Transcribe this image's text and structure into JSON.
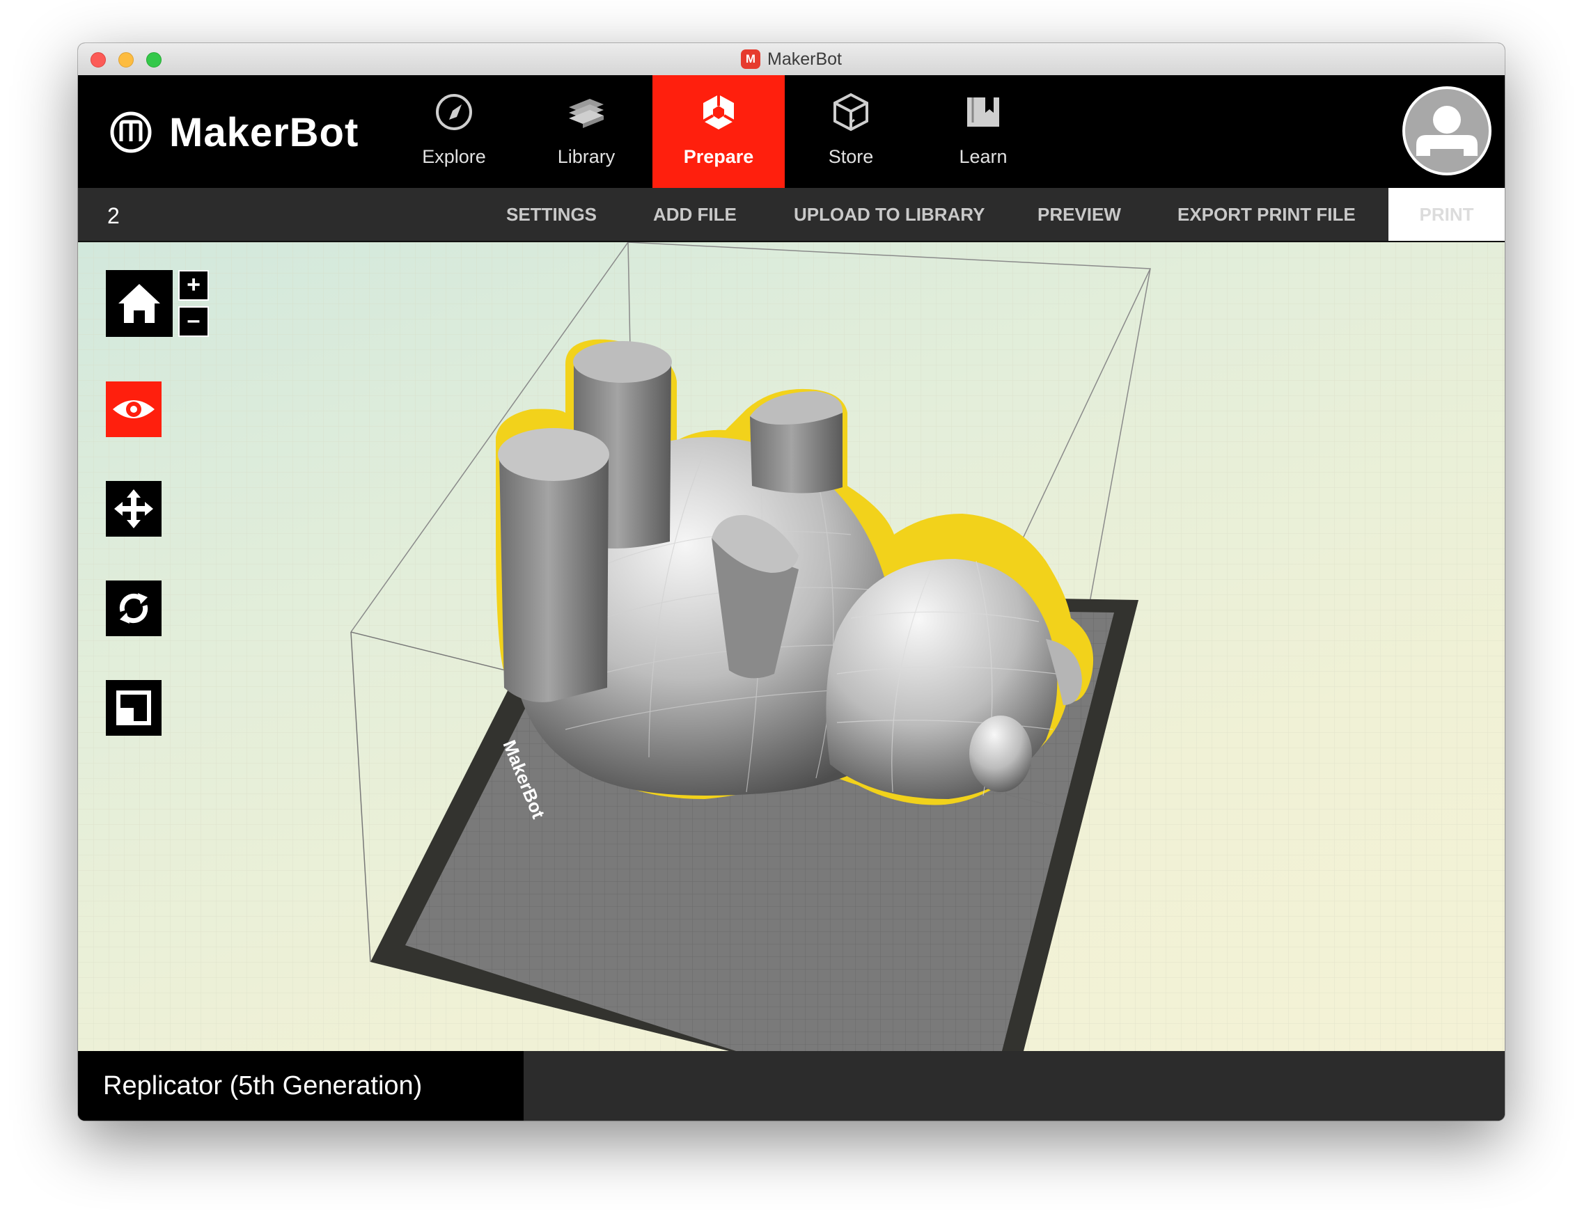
{
  "window": {
    "title": "MakerBot",
    "app_icon_glyph": "M"
  },
  "brand": {
    "logo_text": "MakerBot"
  },
  "nav": {
    "items": [
      {
        "label": "Explore",
        "icon": "compass-icon"
      },
      {
        "label": "Library",
        "icon": "library-stack-icon"
      },
      {
        "label": "Prepare",
        "icon": "prepare-hexagon-icon",
        "active": true
      },
      {
        "label": "Store",
        "icon": "cube-box-icon"
      },
      {
        "label": "Learn",
        "icon": "book-icon"
      }
    ],
    "avatar_icon": "user-avatar-icon"
  },
  "actionbar": {
    "file_count": "2",
    "settings": "SETTINGS",
    "add_file": "ADD FILE",
    "upload": "UPLOAD TO LIBRARY",
    "preview": "PREVIEW",
    "export": "EXPORT PRINT FILE",
    "print": "PRINT"
  },
  "viewport": {
    "view_controls": {
      "home_icon": "home-icon",
      "zoom_in": "+",
      "zoom_out": "–"
    },
    "tools": [
      {
        "icon": "eye-icon",
        "active": true
      },
      {
        "icon": "move-arrows-icon"
      },
      {
        "icon": "rotate-icon"
      },
      {
        "icon": "scale-icon"
      }
    ],
    "build_plate_label": "MakerBot"
  },
  "status": {
    "printer_name": "Replicator (5th Generation)"
  },
  "colors": {
    "accent_red": "#ff1f0d",
    "selection_outline": "#f2d21b",
    "bar_dark": "#2c2c2c"
  }
}
